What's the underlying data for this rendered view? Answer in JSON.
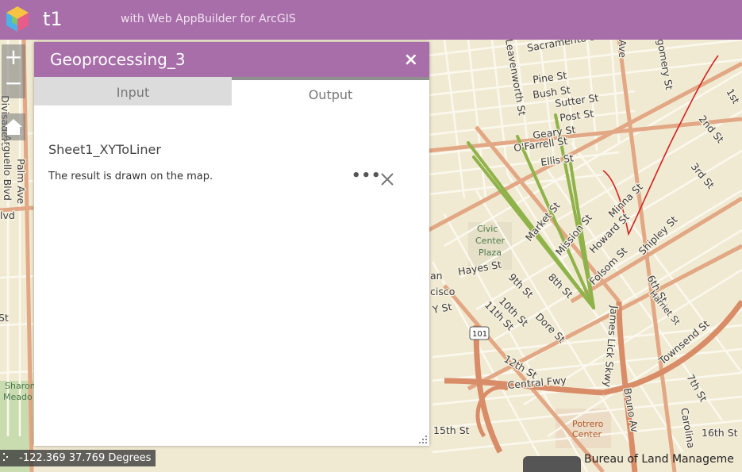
{
  "header": {
    "app_title": "t1",
    "app_subtitle": "with Web AppBuilder for ArcGIS"
  },
  "map_controls": {
    "zoom_in": "+",
    "zoom_out": "−"
  },
  "panel": {
    "title": "Geoprocessing_3",
    "close": "×",
    "tabs": [
      {
        "label": "Input",
        "selected": false
      },
      {
        "label": "Output",
        "selected": true
      }
    ],
    "result": {
      "title": "Sheet1_XYToLiner",
      "message": "The result is drawn on the map.",
      "more": "•••"
    }
  },
  "status": {
    "coordinates": "-122.369 37.769 Degrees"
  },
  "attribution": "Bureau of Land Manageme",
  "map_labels": {
    "streets": [
      "Sacramento St",
      "Pine St",
      "Bush St",
      "Sutter St",
      "Post St",
      "Geary St",
      "O'Farrell St",
      "Ellis St",
      "Market St",
      "Mission St",
      "Howard St",
      "Minna St",
      "Folsom St",
      "Shipley St",
      "Hayes St",
      "9th St",
      "8th St",
      "10th St",
      "11th St",
      "Dore St",
      "12th St",
      "6th St",
      "Harriet St",
      "Townsend St",
      "7th St",
      "Central Fwy",
      "Bruno Av",
      "Carolina",
      "16th St",
      "15th St",
      "James Lick Skwy",
      "2nd St",
      "3rd St",
      "1st",
      "Ave",
      "gomery St",
      "Leavenworth St",
      "Divisadero",
      "Palm Ave",
      "Arguello Blvd",
      "lvd",
      "Blvd",
      "St",
      "an",
      "cisco",
      "St",
      "Y St"
    ],
    "parks": [
      "Civic",
      "Center",
      "Plaza",
      "Sharon",
      "Meado"
    ],
    "places": [
      "Potrero",
      "Center"
    ],
    "shields": [
      "101"
    ]
  },
  "colors": {
    "header": "#a86ea9",
    "green_lines": "#8fb24a",
    "red_line": "#d42020",
    "major_road": "#e0a07a",
    "minor_road": "#ffffff"
  }
}
